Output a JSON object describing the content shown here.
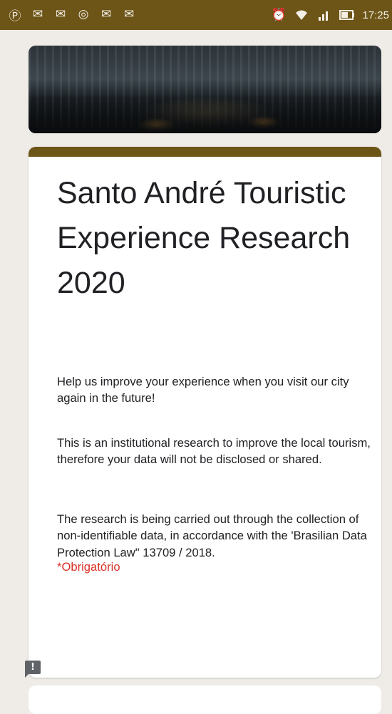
{
  "status_bar": {
    "left_icons": [
      "pinterest-icon",
      "gmail-icon",
      "gmail-icon",
      "instagram-icon",
      "gmail-icon",
      "gmail-icon"
    ],
    "right_icons": [
      "alarm-icon",
      "wifi-icon",
      "signal-icon",
      "battery-icon"
    ],
    "time": "17:25"
  },
  "form": {
    "title": "Santo André Touristic Experience Research 2020",
    "paragraphs": [
      "Help us improve your experience when you visit our city again in the future!",
      "This is an institutional research to improve the local tourism, therefore your data will not be disclosed or shared.",
      "The research is being carried out through the collection of non-identifiable data, in accordance with the 'Brasilian Data Protection Law\" 13709 / 2018."
    ],
    "required_note": "*Obrigatório"
  },
  "colors": {
    "theme": "#6d5417",
    "background": "#efece7",
    "required": "#d93025"
  }
}
